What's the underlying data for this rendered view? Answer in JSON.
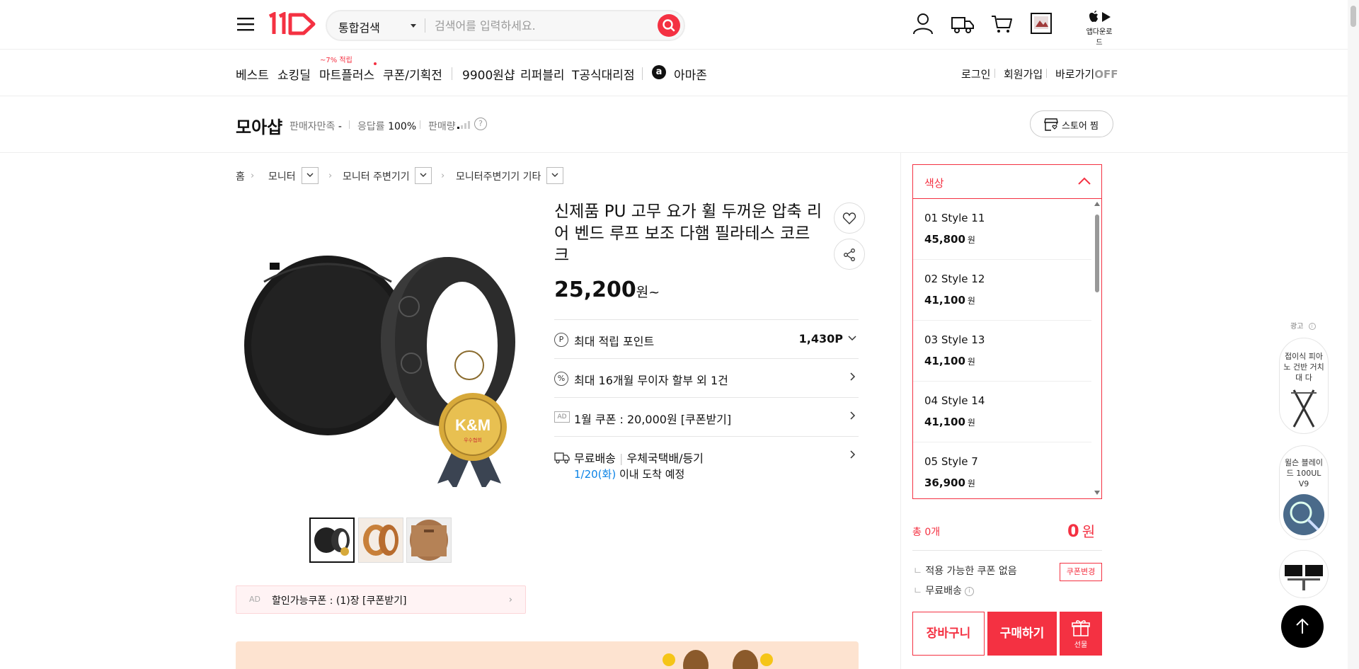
{
  "header": {
    "search_scope": "통합검색",
    "search_placeholder": "검색어를 입력하세요.",
    "app_download": "앱다운로드"
  },
  "nav": {
    "badge": "~7% 적립",
    "items": [
      "베스트",
      "쇼킹딜",
      "마트플러스",
      "쿠폰/기획전",
      "9900원샵",
      "리퍼블리",
      "T공식대리점",
      "아마존"
    ],
    "login": "로그인",
    "signup": "회원가입",
    "shortcut": "바로가기",
    "shortcut_state": "OFF"
  },
  "seller": {
    "name": "모아샵",
    "satisfaction_label": "판매자만족",
    "satisfaction_value": "-",
    "response_label": "응답률",
    "response_value": "100%",
    "sales_label": "판매량",
    "store_button": "스토어 찜"
  },
  "breadcrumb": [
    "홈",
    "모니터",
    "모니터 주변기기",
    "모니터주변기기 기타"
  ],
  "product": {
    "title": "신제품 PU 고무 요가 휠 두꺼운 압축 리어 벤드 루프 보조 다햄 필라테스 코르크",
    "price": "25,200",
    "price_suffix": "원~",
    "badge_text": "K&M",
    "badge_sub": "우수협회",
    "points_label": "최대 적립 포인트",
    "points_value": "1,430P",
    "installment_label": "최대 16개월 무이자 할부 외 1건",
    "ad_tag": "AD",
    "ad_coupon_label": "1월 쿠폰 : 20,000원 [쿠폰받기]",
    "shipping_label": "무료배송",
    "shipping_method": "우체국택배/등기",
    "arrival_date": "1/20(화)",
    "arrival_text": "이내 도착 예정",
    "discount_coupon_ad": "AD",
    "discount_coupon": "할인가능쿠폰 : (1)장 [쿠폰받기]"
  },
  "options": {
    "header": "색상",
    "items": [
      {
        "name": "01 Style 11",
        "price": "45,800",
        "unit": "원"
      },
      {
        "name": "02 Style 12",
        "price": "41,100",
        "unit": "원"
      },
      {
        "name": "03 Style 13",
        "price": "41,100",
        "unit": "원"
      },
      {
        "name": "04 Style 14",
        "price": "41,100",
        "unit": "원"
      },
      {
        "name": "05 Style 7",
        "price": "36,900",
        "unit": "원"
      }
    ]
  },
  "summary": {
    "total_count": "총 0개",
    "total_price": "0",
    "total_unit": "원",
    "coupon_status": "적용 가능한 쿠폰 없음",
    "coupon_change": "쿠폰변경",
    "shipping": "무료배송",
    "cart": "장바구니",
    "buy": "구매하기",
    "gift": "선물"
  },
  "side_ads": {
    "label": "광고",
    "items": [
      "접이식 피아노 건반 거치대 다",
      "윌슨 블레이드 100UL V9",
      ""
    ]
  },
  "colors": {
    "accent": "#f43142",
    "blue": "#0b83e6"
  }
}
